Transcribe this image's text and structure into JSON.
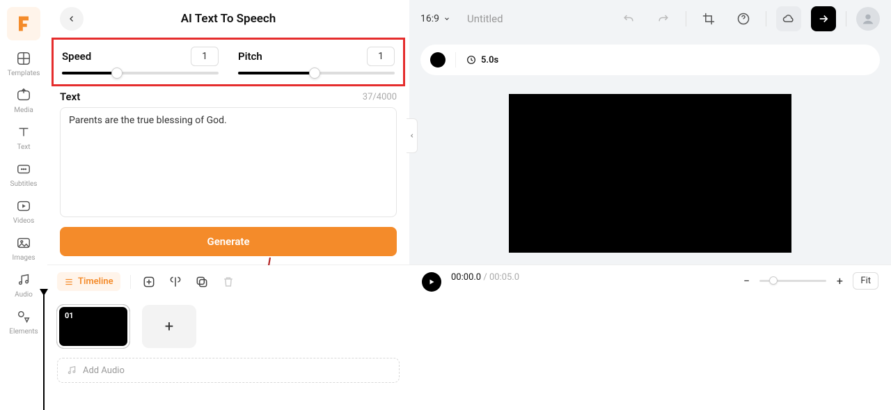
{
  "rail": [
    {
      "label": "Templates"
    },
    {
      "label": "Media"
    },
    {
      "label": "Text"
    },
    {
      "label": "Subtitles"
    },
    {
      "label": "Videos"
    },
    {
      "label": "Images"
    },
    {
      "label": "Audio"
    },
    {
      "label": "Elements"
    }
  ],
  "panel": {
    "title": "AI Text To Speech",
    "speed": {
      "label": "Speed",
      "value": "1",
      "percent": 35
    },
    "pitch": {
      "label": "Pitch",
      "value": "1",
      "percent": 49
    },
    "text_label": "Text",
    "text_count": "37/4000",
    "text_value": "Parents are the true blessing of God.",
    "generate": "Generate"
  },
  "topbar": {
    "aspect": "16:9",
    "title": "Untitled"
  },
  "clipbar": {
    "duration": "5.0s"
  },
  "timeline": {
    "badge": "Timeline",
    "clip_num": "01",
    "add_audio": "Add Audio"
  },
  "playback": {
    "current": "00:00.0",
    "total": "00:05.0",
    "fit": "Fit"
  }
}
